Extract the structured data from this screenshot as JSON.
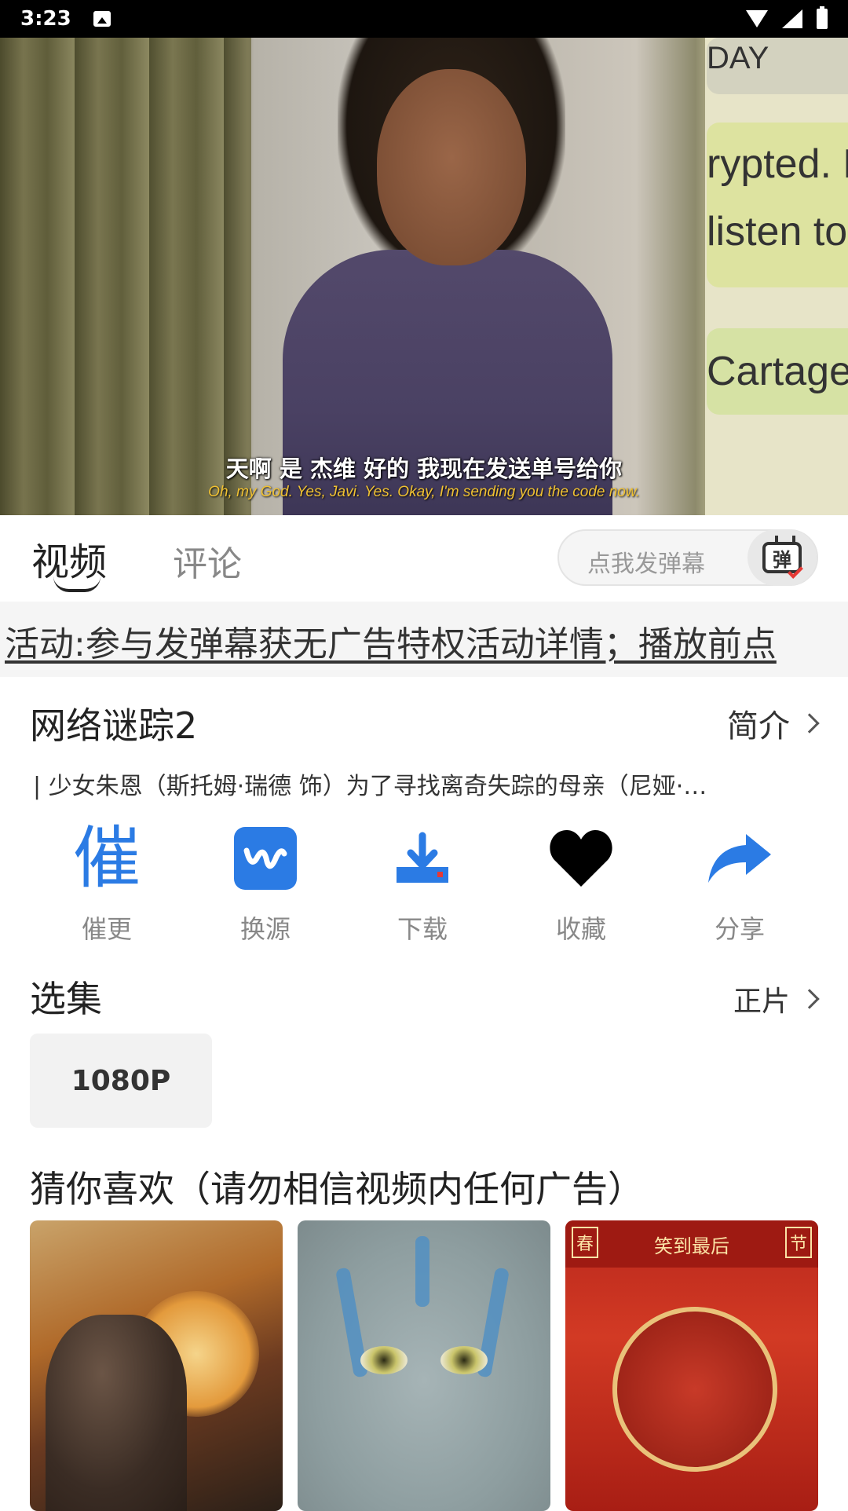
{
  "status_bar": {
    "time": "3:23"
  },
  "video": {
    "subtitle_cn": "天啊 是 杰维 好的 我现在发送单号给你",
    "subtitle_en": "Oh, my God. Yes, Javi. Yes. Okay, I'm sending you the code now.",
    "background_text": [
      "DAY",
      "rypted. N",
      "listen to",
      "Cartage"
    ]
  },
  "tabs": [
    {
      "label": "视频",
      "active": true
    },
    {
      "label": "评论",
      "active": false
    }
  ],
  "danmu": {
    "placeholder": "点我发弹幕",
    "button_glyph": "弹"
  },
  "notice": "活动:参与发弹幕获无广告特权活动详情；播放前点",
  "info": {
    "title": "网络谜踪2",
    "intro_label": "简介",
    "description": "| 少女朱恩（斯托姆·瑞德 饰）为了寻找离奇失踪的母亲（尼娅·…"
  },
  "actions": [
    {
      "label": "催更",
      "glyph": "催",
      "icon": "urge-update-icon"
    },
    {
      "label": "换源",
      "icon": "switch-source-icon"
    },
    {
      "label": "下载",
      "icon": "download-icon"
    },
    {
      "label": "收藏",
      "icon": "heart-icon"
    },
    {
      "label": "分享",
      "icon": "share-icon"
    }
  ],
  "episodes": {
    "title": "选集",
    "link_label": "正片",
    "items": [
      "1080P"
    ]
  },
  "recommend": {
    "title": "猜你喜欢（请勿相信视频内任何广告）",
    "poster3_banner": "笑到最后",
    "poster3_tag_left": "春",
    "poster3_tag_right": "节"
  },
  "colors": {
    "accent": "#2b7be4",
    "danmu_check": "#e53935"
  }
}
